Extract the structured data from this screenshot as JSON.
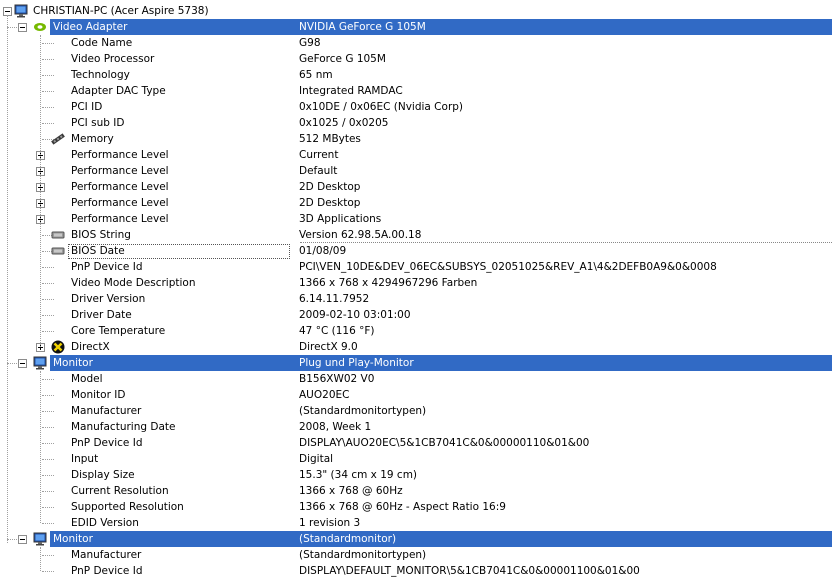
{
  "root": {
    "label": "CHRISTIAN-PC (Acer Aspire 5738)",
    "icon": "computer-icon"
  },
  "groups": [
    {
      "label": "Video Adapter",
      "value": "NVIDIA GeForce G 105M",
      "icon": "nvidia-icon",
      "items": [
        {
          "label": "Code Name",
          "value": "G98"
        },
        {
          "label": "Video Processor",
          "value": "GeForce G 105M"
        },
        {
          "label": "Technology",
          "value": "65 nm"
        },
        {
          "label": "Adapter DAC Type",
          "value": "Integrated RAMDAC"
        },
        {
          "label": "PCI ID",
          "value": "0x10DE / 0x06EC (Nvidia Corp)"
        },
        {
          "label": "PCI sub ID",
          "value": "0x1025 / 0x0205"
        },
        {
          "label": "Memory",
          "value": "512 MBytes",
          "icon": "memory-icon"
        },
        {
          "label": "Performance Level",
          "value": "Current",
          "expandable": true
        },
        {
          "label": "Performance Level",
          "value": "Default",
          "expandable": true
        },
        {
          "label": "Performance Level",
          "value": "2D Desktop",
          "expandable": true
        },
        {
          "label": "Performance Level",
          "value": "2D Desktop",
          "expandable": true
        },
        {
          "label": "Performance Level",
          "value": "3D Applications",
          "expandable": true
        },
        {
          "label": "BIOS String",
          "value": "Version 62.98.5A.00.18",
          "icon": "chip-icon"
        },
        {
          "label": "BIOS Date",
          "value": "01/08/09",
          "icon": "chip-icon",
          "focused": true
        },
        {
          "label": "PnP Device Id",
          "value": "PCI\\VEN_10DE&DEV_06EC&SUBSYS_02051025&REV_A1\\4&2DEFB0A9&0&0008"
        },
        {
          "label": "Video Mode Description",
          "value": "1366 x 768 x 4294967296 Farben"
        },
        {
          "label": "Driver Version",
          "value": "6.14.11.7952"
        },
        {
          "label": "Driver Date",
          "value": "2009-02-10 03:01:00"
        },
        {
          "label": "Core Temperature",
          "value": "47 °C  (116 °F)"
        },
        {
          "label": "DirectX",
          "value": "DirectX 9.0",
          "icon": "directx-icon",
          "expandable": true
        }
      ]
    },
    {
      "label": "Monitor",
      "value": "Plug und Play-Monitor",
      "icon": "monitor-icon",
      "items": [
        {
          "label": "Model",
          "value": "B156XW02 V0"
        },
        {
          "label": "Monitor ID",
          "value": "AUO20EC"
        },
        {
          "label": "Manufacturer",
          "value": "(Standardmonitortypen)"
        },
        {
          "label": "Manufacturing Date",
          "value": "2008, Week 1"
        },
        {
          "label": "PnP Device Id",
          "value": "DISPLAY\\AUO20EC\\5&1CB7041C&0&00000110&01&00"
        },
        {
          "label": "Input",
          "value": "Digital"
        },
        {
          "label": "Display Size",
          "value": "15.3\" (34 cm x 19 cm)"
        },
        {
          "label": "Current Resolution",
          "value": "1366 x 768 @ 60Hz"
        },
        {
          "label": "Supported Resolution",
          "value": "1366 x 768 @ 60Hz - Aspect Ratio 16:9"
        },
        {
          "label": "EDID Version",
          "value": "1 revision 3"
        }
      ]
    },
    {
      "label": "Monitor",
      "value": "(Standardmonitor)",
      "icon": "monitor-icon",
      "items": [
        {
          "label": "Manufacturer",
          "value": "(Standardmonitortypen)"
        },
        {
          "label": "PnP Device Id",
          "value": "DISPLAY\\DEFAULT_MONITOR\\5&1CB7041C&0&00001100&01&00"
        }
      ]
    }
  ],
  "colors": {
    "selection": "#316ac5",
    "tree_lines": "#a0a0a0"
  }
}
